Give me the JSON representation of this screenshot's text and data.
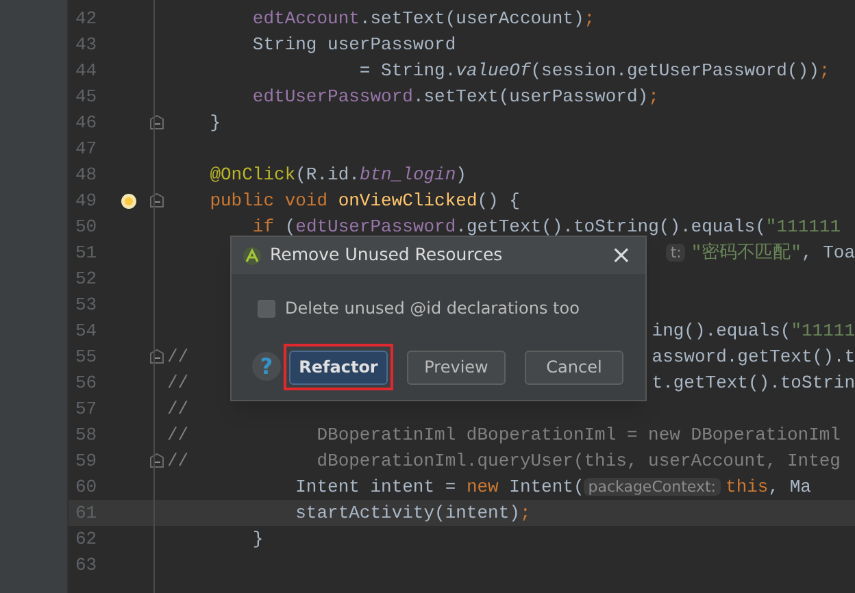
{
  "editor": {
    "lines": [
      {
        "number": "42",
        "current": false,
        "fold": false,
        "bulb": false,
        "segments": [
          {
            "text": "        edtAccount",
            "kind": "field"
          },
          {
            "text": ".setText(userAccount)",
            "kind": "plain"
          },
          {
            "text": ";",
            "kind": "keyword"
          }
        ]
      },
      {
        "number": "43",
        "current": false,
        "fold": false,
        "bulb": false,
        "segments": [
          {
            "text": "        String userPassword",
            "kind": "plain"
          }
        ]
      },
      {
        "number": "44",
        "current": false,
        "fold": false,
        "bulb": false,
        "segments": [
          {
            "text": "                  = String.",
            "kind": "plain"
          },
          {
            "text": "valueOf",
            "kind": "italic"
          },
          {
            "text": "(session.getUserPassword())",
            "kind": "plain"
          },
          {
            "text": ";",
            "kind": "keyword"
          }
        ]
      },
      {
        "number": "45",
        "current": false,
        "fold": false,
        "bulb": false,
        "segments": [
          {
            "text": "        edtUserPassword",
            "kind": "field"
          },
          {
            "text": ".setText(userPassword)",
            "kind": "plain"
          },
          {
            "text": ";",
            "kind": "keyword"
          }
        ]
      },
      {
        "number": "46",
        "current": false,
        "fold": true,
        "bulb": false,
        "segments": [
          {
            "text": "    }",
            "kind": "plain"
          }
        ]
      },
      {
        "number": "47",
        "current": false,
        "fold": false,
        "bulb": false
      },
      {
        "number": "48",
        "current": false,
        "fold": false,
        "bulb": false,
        "segments": [
          {
            "text": "    @OnClick",
            "kind": "annotation"
          },
          {
            "text": "(R.id.",
            "kind": "plain"
          },
          {
            "text": "btn_login",
            "kind": "field-italic"
          },
          {
            "text": ")",
            "kind": "plain"
          }
        ]
      },
      {
        "number": "49",
        "current": false,
        "fold": true,
        "bulb": true,
        "segments": [
          {
            "text": "    public void ",
            "kind": "keyword"
          },
          {
            "text": "onViewClicked",
            "kind": "method"
          },
          {
            "text": "() {",
            "kind": "plain"
          }
        ]
      },
      {
        "number": "50",
        "current": false,
        "fold": false,
        "bulb": false,
        "segments": [
          {
            "text": "        if ",
            "kind": "keyword"
          },
          {
            "text": "(",
            "kind": "plain"
          },
          {
            "text": "edtUserPassword",
            "kind": "field"
          },
          {
            "text": ".getText().toString().equals(",
            "kind": "plain"
          },
          {
            "text": "\"111111",
            "kind": "string"
          }
        ]
      },
      {
        "number": "51",
        "current": false,
        "fold": false,
        "bulb": false,
        "tail": [
          {
            "text": "t:",
            "kind": "hint"
          },
          {
            "text": "\"密码不匹配\"",
            "kind": "string"
          },
          {
            "text": ", Toa",
            "kind": "plain"
          }
        ]
      },
      {
        "number": "52",
        "current": false,
        "fold": false,
        "bulb": false
      },
      {
        "number": "53",
        "current": false,
        "fold": false,
        "bulb": false
      },
      {
        "number": "54",
        "current": false,
        "fold": false,
        "bulb": false,
        "tail": [
          {
            "text": "ing().equals(",
            "kind": "plain"
          },
          {
            "text": "\"11111",
            "kind": "string"
          }
        ]
      },
      {
        "number": "55",
        "current": false,
        "fold": true,
        "bulb": false,
        "segments": [
          {
            "text": "//",
            "kind": "comment"
          }
        ],
        "tail": [
          {
            "text": "assword.getText().t",
            "kind": "plain"
          }
        ]
      },
      {
        "number": "56",
        "current": false,
        "fold": false,
        "bulb": false,
        "segments": [
          {
            "text": "//",
            "kind": "comment"
          }
        ],
        "tail": [
          {
            "text": "t.getText().toStrin",
            "kind": "plain"
          }
        ]
      },
      {
        "number": "57",
        "current": false,
        "fold": false,
        "bulb": false,
        "segments": [
          {
            "text": "//",
            "kind": "comment"
          }
        ]
      },
      {
        "number": "58",
        "current": false,
        "fold": false,
        "bulb": false,
        "segments": [
          {
            "text": "//            DBoperatinIml dBoperationIml = new DBoperationIml",
            "kind": "comment"
          }
        ]
      },
      {
        "number": "59",
        "current": false,
        "fold": true,
        "bulb": false,
        "segments": [
          {
            "text": "//            dBoperationIml.queryUser(this, userAccount, Integ",
            "kind": "comment"
          }
        ]
      },
      {
        "number": "60",
        "current": false,
        "fold": false,
        "bulb": false,
        "segments": [
          {
            "text": "            Intent intent = ",
            "kind": "plain"
          },
          {
            "text": "new ",
            "kind": "keyword"
          },
          {
            "text": "Intent(",
            "kind": "plain"
          },
          {
            "text": "packageContext:",
            "kind": "hint"
          },
          {
            "text": "this",
            "kind": "keyword"
          },
          {
            "text": ", Ma",
            "kind": "plain"
          }
        ]
      },
      {
        "number": "61",
        "current": true,
        "fold": false,
        "bulb": false,
        "segments": [
          {
            "text": "            startActivity(intent)",
            "kind": "plain"
          },
          {
            "text": ";",
            "kind": "keyword"
          }
        ]
      },
      {
        "number": "62",
        "current": false,
        "fold": false,
        "bulb": false,
        "segments": [
          {
            "text": "        }",
            "kind": "plain"
          }
        ]
      },
      {
        "number": "63",
        "current": false,
        "fold": false,
        "bulb": false
      }
    ]
  },
  "dialog": {
    "title": "Remove Unused Resources",
    "close": "×",
    "checkbox": {
      "label": "Delete unused @id declarations too",
      "checked": false
    },
    "help": "?",
    "buttons": [
      {
        "label": "Refactor",
        "default": true,
        "highlighted": true
      },
      {
        "label": "Preview",
        "default": false,
        "highlighted": false
      },
      {
        "label": "Cancel",
        "default": false,
        "highlighted": false
      }
    ]
  }
}
